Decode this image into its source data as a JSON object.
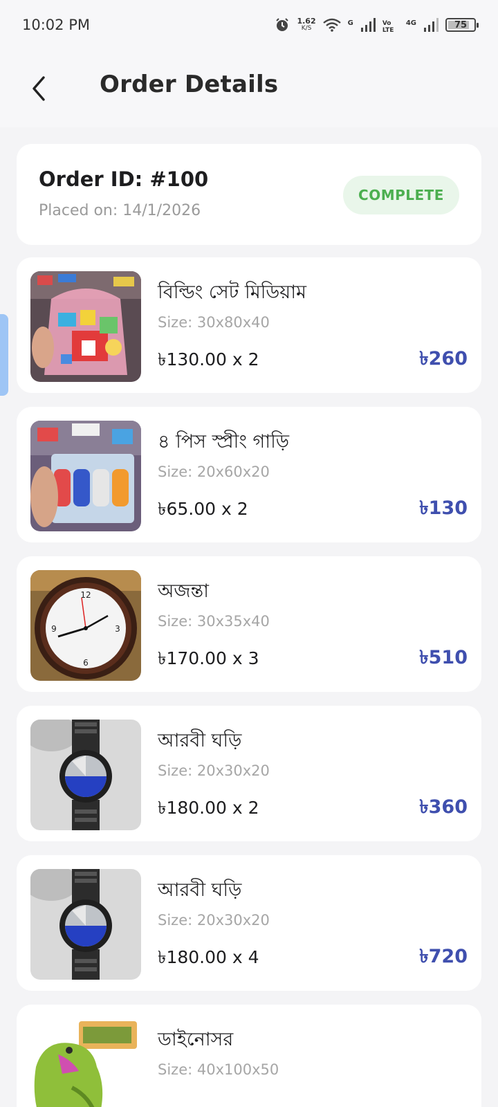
{
  "status_bar": {
    "time": "10:02 PM",
    "net_speed": "1.62",
    "net_unit": "K/S",
    "sim1_label": "G",
    "sim1_volte": "Vo LTE",
    "sim2_label": "4G",
    "battery": "75"
  },
  "header": {
    "title": "Order Details",
    "back_icon": "chevron-left-icon"
  },
  "order": {
    "id": "Order ID: #100",
    "placed_on": "Placed on: 14/1/2026",
    "status": "COMPLETE",
    "status_color": "#4caf50"
  },
  "items": [
    {
      "name": "বিল্ডিং সেট মিডিয়াম",
      "size": "Size: 30x80x40",
      "price_qty": "৳130.00 x 2",
      "total": "৳260",
      "image": "building-blocks-toy-image"
    },
    {
      "name": "৪ পিস স্প্রীং গাড়ি",
      "size": "Size: 20x60x20",
      "price_qty": "৳65.00 x 2",
      "total": "৳130",
      "image": "toy-cars-pack-image"
    },
    {
      "name": "অজন্তা",
      "size": "Size: 30x35x40",
      "price_qty": "৳170.00 x 3",
      "total": "৳510",
      "image": "wall-clock-image"
    },
    {
      "name": "আরবী ঘড়ি",
      "size": "Size: 20x30x20",
      "price_qty": "৳180.00 x 2",
      "total": "৳360",
      "image": "wrist-watch-image"
    },
    {
      "name": "আরবী ঘড়ি",
      "size": "Size: 20x30x20",
      "price_qty": "৳180.00 x 4",
      "total": "৳720",
      "image": "wrist-watch-image"
    },
    {
      "name": "ডাইনোসর",
      "size": "Size: 40x100x50",
      "price_qty": "",
      "total": "",
      "image": "dinosaur-toy-image"
    }
  ],
  "colors": {
    "accent_total": "#3f4fae",
    "badge_bg": "#e9f6ea",
    "page_bg": "#f4f4f6"
  }
}
